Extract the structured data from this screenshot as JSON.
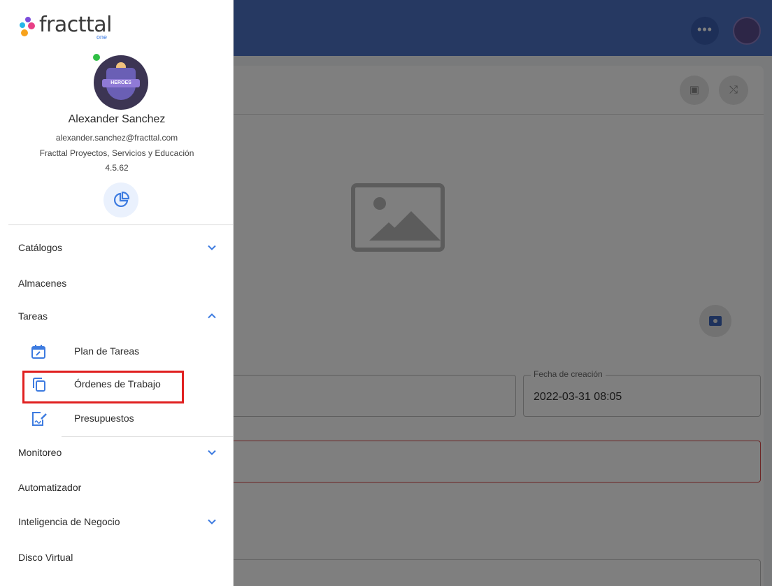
{
  "app": {
    "more_label": "•••",
    "date_field": {
      "label": "Fecha de creación",
      "value": "2022-03-31 08:05"
    }
  },
  "drawer": {
    "logo": {
      "word": "fracttal",
      "sub": "one"
    },
    "user": {
      "name": "Alexander Sanchez",
      "email": "alexander.sanchez@fracttal.com",
      "organization": "Fracttal Proyectos, Servicios y Educación",
      "version": "4.5.62",
      "avatar_badge": "HEROES"
    },
    "menu": [
      {
        "label": "Catálogos",
        "expandable": true,
        "expanded": false
      },
      {
        "label": "Almacenes",
        "expandable": false
      },
      {
        "label": "Tareas",
        "expandable": true,
        "expanded": true
      },
      {
        "label": "Monitoreo",
        "expandable": true,
        "expanded": false
      },
      {
        "label": "Automatizador",
        "expandable": false
      },
      {
        "label": "Inteligencia de Negocio",
        "expandable": true,
        "expanded": false
      },
      {
        "label": "Disco Virtual",
        "expandable": false
      }
    ],
    "tareas_sub": [
      {
        "label": "Plan de Tareas",
        "icon": "calendar-edit-icon"
      },
      {
        "label": "Órdenes de Trabajo",
        "icon": "copy-icon",
        "highlighted": true
      },
      {
        "label": "Presupuestos",
        "icon": "document-signature-icon"
      }
    ]
  },
  "colors": {
    "accent": "#3d7be0",
    "topbar": "#4d72c4",
    "highlight_border": "#e02020"
  }
}
